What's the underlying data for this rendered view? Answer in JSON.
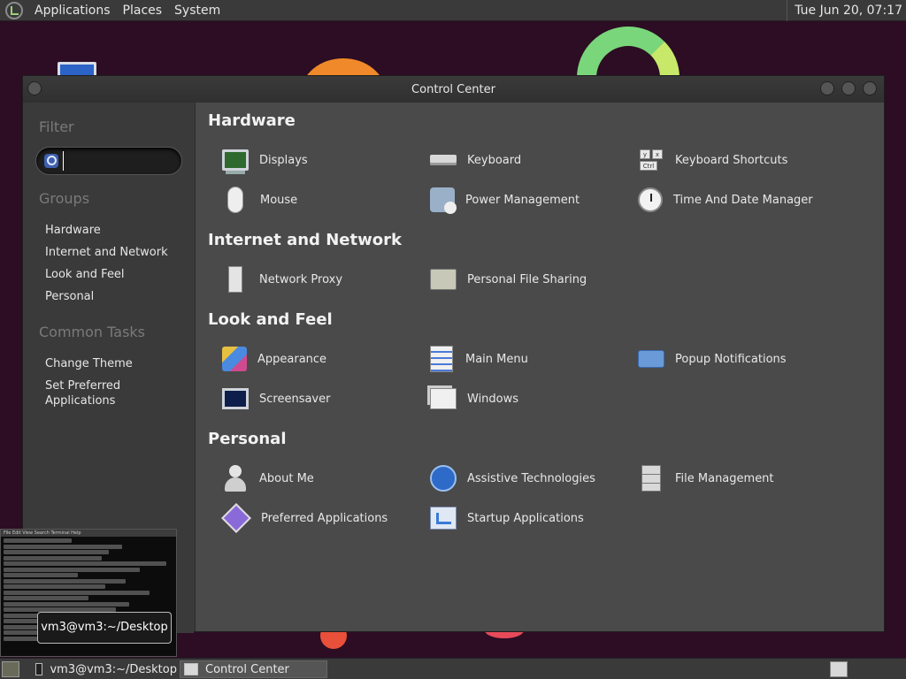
{
  "top_panel": {
    "menus": [
      "Applications",
      "Places",
      "System"
    ],
    "clock": "Tue Jun 20, 07:17"
  },
  "window": {
    "title": "Control Center"
  },
  "sidebar": {
    "filter_heading": "Filter",
    "search_value": "",
    "groups_heading": "Groups",
    "groups": [
      "Hardware",
      "Internet and Network",
      "Look and Feel",
      "Personal"
    ],
    "tasks_heading": "Common Tasks",
    "tasks": [
      "Change Theme",
      "Set Preferred Applications"
    ]
  },
  "categories": {
    "hardware": {
      "title": "Hardware",
      "items": [
        "Displays",
        "Keyboard",
        "Keyboard Shortcuts",
        "Mouse",
        "Power Management",
        "Time And Date Manager"
      ]
    },
    "network": {
      "title": "Internet and Network",
      "items": [
        "Network Proxy",
        "Personal File Sharing"
      ]
    },
    "look": {
      "title": "Look and Feel",
      "items": [
        "Appearance",
        "Main Menu",
        "Popup Notifications",
        "Screensaver",
        "Windows"
      ]
    },
    "personal": {
      "title": "Personal",
      "items": [
        "About Me",
        "Assistive Technologies",
        "File Management",
        "Preferred Applications",
        "Startup Applications"
      ]
    }
  },
  "icons": {
    "shortcut_keys": [
      "y",
      "x",
      "Ctrl"
    ]
  },
  "terminal_preview": {
    "menubar": "File  Edit  View  Search  Terminal  Help"
  },
  "tooltip": "vm3@vm3:~/Desktop",
  "taskbar": {
    "tasks": [
      "vm3@vm3:~/Desktop",
      "Control Center"
    ]
  }
}
